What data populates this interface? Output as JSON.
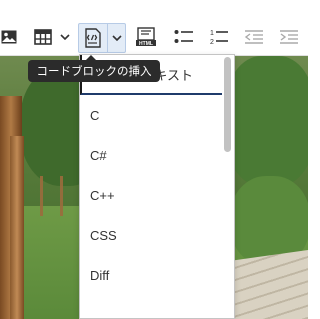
{
  "toolbar": {
    "buttons": [
      {
        "name": "image-icon"
      },
      {
        "name": "table-icon"
      },
      {
        "name": "codeblock-icon"
      },
      {
        "name": "html-embed-icon",
        "label": "HTML"
      },
      {
        "name": "bulleted-list-icon"
      },
      {
        "name": "numbered-list-icon"
      },
      {
        "name": "outdent-icon"
      },
      {
        "name": "indent-icon"
      }
    ],
    "active_color": "#e3ecf7"
  },
  "tooltip": {
    "text": "コードブロックの挿入"
  },
  "codeblock_menu": {
    "items": [
      {
        "label": "プレーンテキスト",
        "selected": true
      },
      {
        "label": "C"
      },
      {
        "label": "C#"
      },
      {
        "label": "C++"
      },
      {
        "label": "CSS"
      },
      {
        "label": "Diff"
      }
    ]
  }
}
